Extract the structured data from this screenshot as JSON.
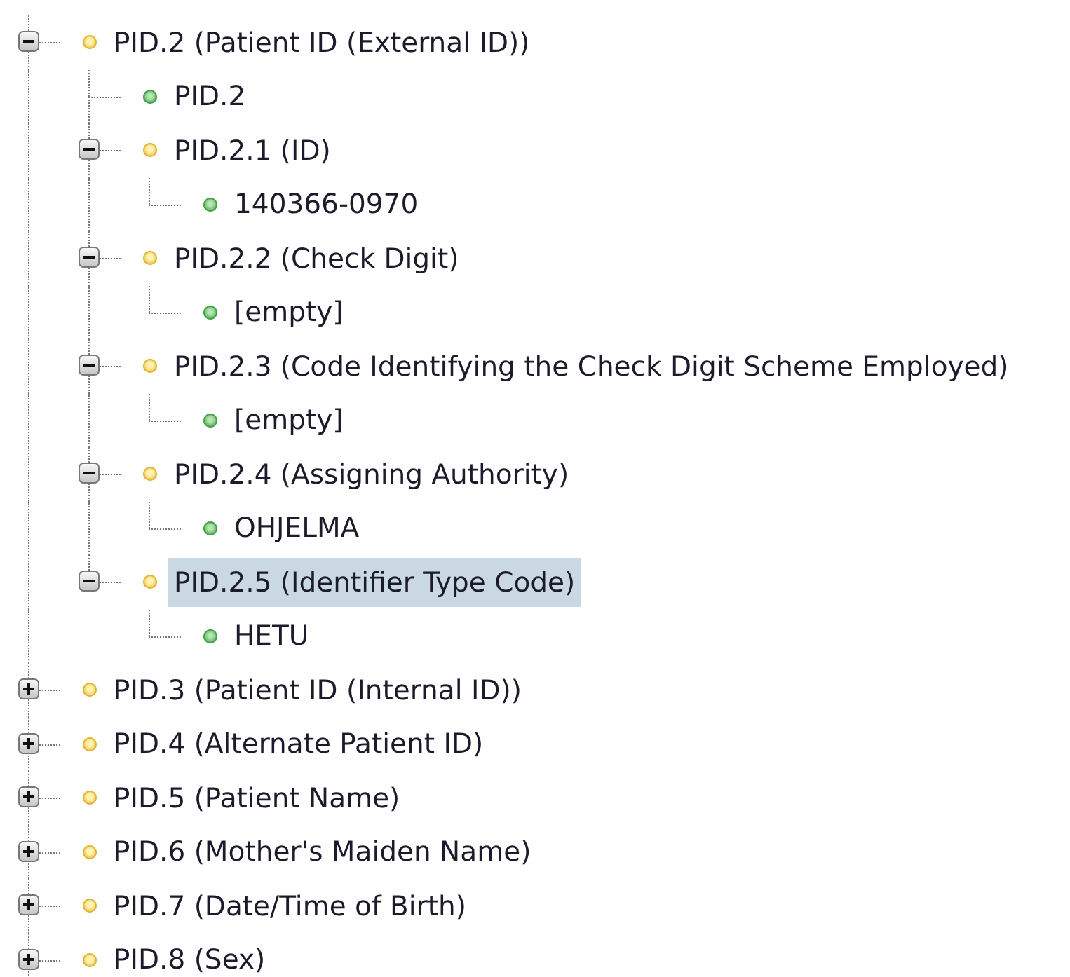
{
  "tree": [
    {
      "label": "PID.2 (Patient ID (External ID))",
      "kind": "field",
      "expanded": true,
      "selected": false,
      "children": [
        {
          "label": "PID.2",
          "kind": "value",
          "selected": false
        },
        {
          "label": "PID.2.1 (ID)",
          "kind": "field",
          "expanded": true,
          "selected": false,
          "children": [
            {
              "label": "140366-0970",
              "kind": "value",
              "selected": false
            }
          ]
        },
        {
          "label": "PID.2.2 (Check Digit)",
          "kind": "field",
          "expanded": true,
          "selected": false,
          "children": [
            {
              "label": "[empty]",
              "kind": "value",
              "selected": false
            }
          ]
        },
        {
          "label": "PID.2.3 (Code Identifying the Check Digit Scheme Employed)",
          "kind": "field",
          "expanded": true,
          "selected": false,
          "children": [
            {
              "label": "[empty]",
              "kind": "value",
              "selected": false
            }
          ]
        },
        {
          "label": "PID.2.4 (Assigning Authority)",
          "kind": "field",
          "expanded": true,
          "selected": false,
          "children": [
            {
              "label": "OHJELMA",
              "kind": "value",
              "selected": false
            }
          ]
        },
        {
          "label": "PID.2.5 (Identifier Type Code)",
          "kind": "field",
          "expanded": true,
          "selected": true,
          "children": [
            {
              "label": "HETU",
              "kind": "value",
              "selected": false
            }
          ]
        }
      ]
    },
    {
      "label": "PID.3 (Patient ID (Internal ID))",
      "kind": "field",
      "expanded": false,
      "selected": false
    },
    {
      "label": "PID.4 (Alternate Patient ID)",
      "kind": "field",
      "expanded": false,
      "selected": false
    },
    {
      "label": "PID.5 (Patient Name)",
      "kind": "field",
      "expanded": false,
      "selected": false
    },
    {
      "label": "PID.6 (Mother's Maiden Name)",
      "kind": "field",
      "expanded": false,
      "selected": false
    },
    {
      "label": "PID.7 (Date/Time of Birth)",
      "kind": "field",
      "expanded": false,
      "selected": false
    },
    {
      "label": "PID.8 (Sex)",
      "kind": "field",
      "expanded": false,
      "selected": false
    }
  ]
}
